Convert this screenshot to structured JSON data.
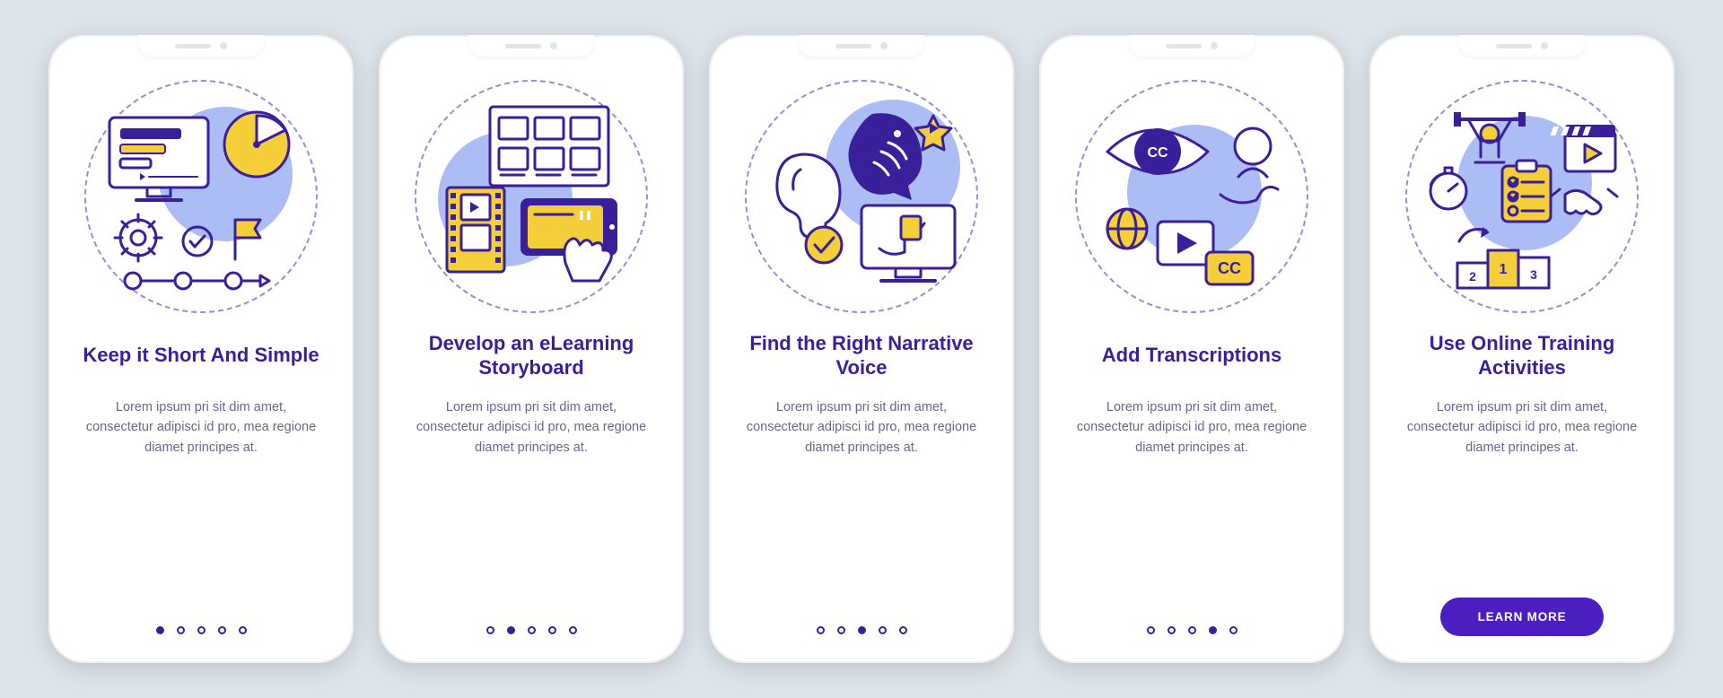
{
  "colors": {
    "primary": "#3a1f9a",
    "accent": "#f5cf3a",
    "light": "#98aef1",
    "cta": "#4b1fbf"
  },
  "screens": [
    {
      "title": "Keep it Short And Simple",
      "body": "Lorem ipsum pri sit dim amet, consectetur adipisci id pro, mea regione diamet principes at.",
      "active_dot": 0
    },
    {
      "title": "Develop an eLearning Storyboard",
      "body": "Lorem ipsum pri sit dim amet, consectetur adipisci id pro, mea regione diamet principes at.",
      "active_dot": 1
    },
    {
      "title": "Find the Right Narrative Voice",
      "body": "Lorem ipsum pri sit dim amet, consectetur adipisci id pro, mea regione diamet principes at.",
      "active_dot": 2
    },
    {
      "title": "Add Transcriptions",
      "body": "Lorem ipsum pri sit dim amet, consectetur adipisci id pro, mea regione diamet principes at.",
      "active_dot": 3
    },
    {
      "title": "Use Online Training Activities",
      "body": "Lorem ipsum pri sit dim amet, consectetur adipisci id pro, mea regione diamet principes at.",
      "active_dot": 4,
      "cta_label": "LEARN MORE"
    }
  ],
  "dot_count": 5
}
